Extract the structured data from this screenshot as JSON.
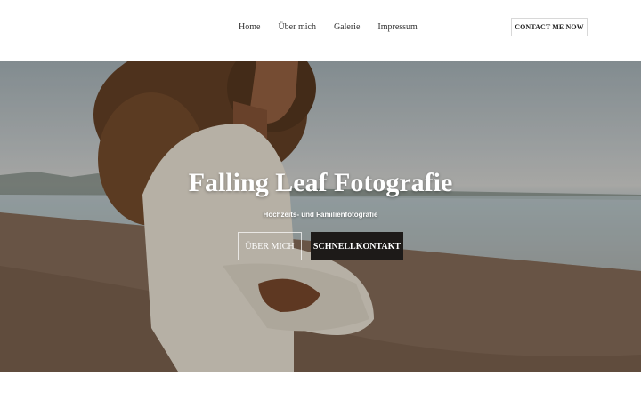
{
  "nav": {
    "items": [
      {
        "label": "Home"
      },
      {
        "label": "Über mich"
      },
      {
        "label": "Galerie"
      },
      {
        "label": "Impressum"
      }
    ],
    "cta_label": "CONTACT ME NOW"
  },
  "hero": {
    "title": "Falling Leaf Fotografie",
    "subtitle": "Hochzeits- und Familienfotografie",
    "button_primary": "ÜBER MICH",
    "button_secondary": "SCHNELLKONTAKT",
    "image_description_icon": "photo-woman-beach"
  },
  "colors": {
    "accent_dark": "#1d1a18",
    "text_dark": "#333333"
  }
}
